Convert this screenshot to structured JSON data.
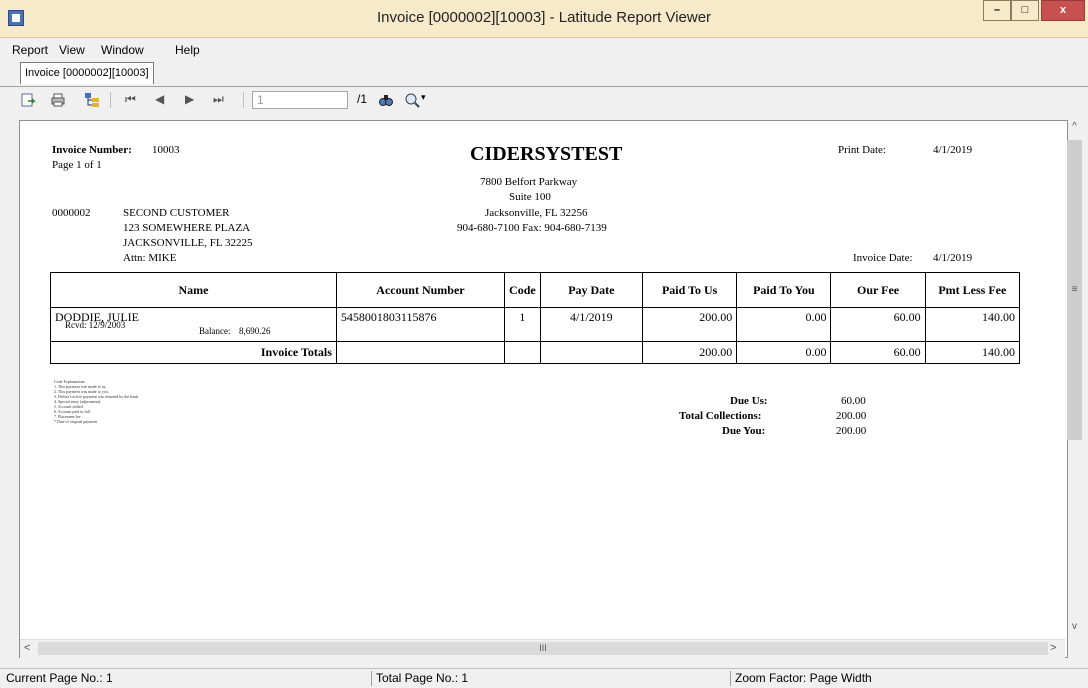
{
  "window": {
    "title": "Invoice [0000002][10003] - Latitude Report Viewer",
    "min_label": "–",
    "max_label": "□",
    "close_label": "x"
  },
  "menu": [
    "Report",
    "View",
    "Window",
    "Help"
  ],
  "tab": {
    "label": "Invoice [0000002][10003]"
  },
  "toolbar": {
    "page_value": "1",
    "page_total": "/1",
    "icons": [
      "export-icon",
      "print-icon",
      "group-tree-icon",
      "first-page-icon",
      "prev-page-icon",
      "next-page-icon",
      "last-page-icon",
      "find-icon",
      "zoom-icon"
    ],
    "nav_first": "⏮",
    "nav_prev": "◀",
    "nav_next": "▶",
    "nav_last": "⏭"
  },
  "report": {
    "invoice_number_label": "Invoice Number:",
    "invoice_number": "10003",
    "page_of": "Page 1 of 1",
    "company": "CIDERSYSTEST",
    "address1": "7800 Belfort Parkway",
    "address2": "Suite 100",
    "city": "Jacksonville, FL  32256",
    "phone": "904-680-7100   Fax: 904-680-7139",
    "print_date_label": "Print Date:",
    "print_date": "4/1/2019",
    "customer_id": "0000002",
    "customer_name": "SECOND CUSTOMER",
    "customer_addr1": "123 SOMEWHERE PLAZA",
    "customer_city": "JACKSONVILLE, FL  32225",
    "customer_attn": "Attn: MIKE",
    "invoice_date_label": "Invoice Date:",
    "invoice_date": "4/1/2019",
    "columns": [
      "Name",
      "Account Number",
      "Code",
      "Pay Date",
      "Paid To Us",
      "Paid To You",
      "Our Fee",
      "Pmt Less Fee"
    ],
    "rows": [
      {
        "name": "DODDIE, JULIE",
        "rcvd": "Rcvd: 12/9/2003",
        "balance_label": "Balance:",
        "balance": "8,690.26",
        "account": "5458001803115876",
        "code": "1",
        "pay_date": "4/1/2019",
        "paid_to_us": "200.00",
        "paid_to_you": "0.00",
        "our_fee": "60.00",
        "pmt_less_fee": "140.00"
      }
    ],
    "totals": {
      "label": "Invoice Totals",
      "paid_to_us": "200.00",
      "paid_to_you": "0.00",
      "our_fee": "60.00",
      "pmt_less_fee": "140.00"
    },
    "code_legend": [
      "Code Explanations:",
      "1. This payment was made to us.",
      "2. This payment was made to you.",
      "3. Debtor's active payment was returned by the bank.",
      "4. Special entry (adjustment).",
      "5. Account settled.",
      "6. Account paid in full.",
      "7. Placement fee.",
      "* Date of original payment"
    ],
    "summary": [
      {
        "label": "Due Us:",
        "value": "60.00"
      },
      {
        "label": "Total Collections:",
        "value": "200.00"
      },
      {
        "label": "Due You:",
        "value": "200.00"
      }
    ]
  },
  "status": {
    "current_page": "Current Page No.: 1",
    "total_page": "Total Page No.: 1",
    "zoom": "Zoom Factor: Page Width"
  },
  "scroll": {
    "left_arrow": "<",
    "right_arrow": ">",
    "up_arrow": "^",
    "down_arrow": "v",
    "thumb_grip": "III",
    "v_thumb_grip": "≡"
  }
}
